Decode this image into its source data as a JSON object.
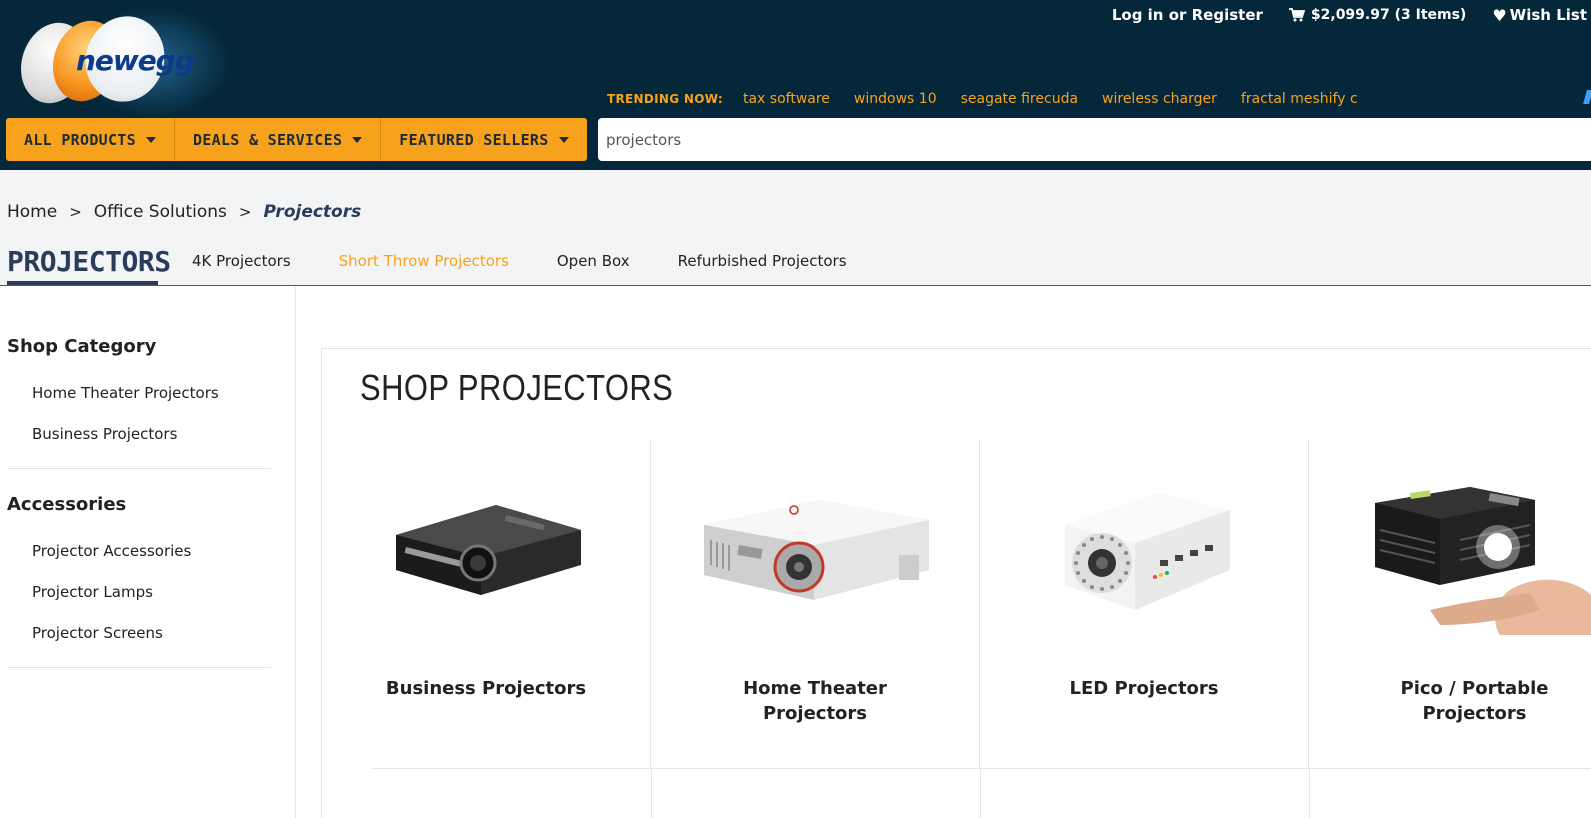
{
  "logo": {
    "text": "newegg",
    "tm": "®"
  },
  "header": {
    "login_text": "Log in or Register",
    "cart_text": "$2,099.97 (3 Items)",
    "wishlist_text": "Wish List",
    "trending_label": "TRENDING NOW:",
    "trending": [
      "tax software",
      "windows 10",
      "seagate firecuda",
      "wireless charger",
      "fractal meshify c"
    ]
  },
  "menu": {
    "items": [
      {
        "label": "ALL PRODUCTS"
      },
      {
        "label": "DEALS & SERVICES"
      },
      {
        "label": "FEATURED SELLERS"
      }
    ]
  },
  "search": {
    "value": "projectors"
  },
  "breadcrumb": {
    "items": [
      "Home",
      "Office Solutions"
    ],
    "separator": ">",
    "current": "Projectors"
  },
  "page": {
    "title": "PROJECTORS",
    "subtabs": [
      {
        "label": "4K Projectors",
        "active": false
      },
      {
        "label": "Short Throw Projectors",
        "active": true
      },
      {
        "label": "Open Box",
        "active": false
      },
      {
        "label": "Refurbished Projectors",
        "active": false
      }
    ]
  },
  "sidebar": {
    "groups": [
      {
        "title": "Shop Category",
        "items": [
          "Home Theater Projectors",
          "Business Projectors"
        ]
      },
      {
        "title": "Accessories",
        "items": [
          "Projector Accessories",
          "Projector Lamps",
          "Projector Screens"
        ]
      }
    ]
  },
  "main": {
    "title": "SHOP PROJECTORS",
    "cards": [
      {
        "label": "Business Projectors",
        "icon": "business-projector-image"
      },
      {
        "label": "Home Theater Projectors",
        "icon": "home-theater-projector-image"
      },
      {
        "label": "LED Projectors",
        "icon": "led-projector-image"
      },
      {
        "label": "Pico / Portable Projectors",
        "icon": "pico-projector-image"
      }
    ]
  },
  "colors": {
    "header_bg": "#042739",
    "accent": "#f7a21d",
    "title_blue": "#2b3c5a"
  }
}
